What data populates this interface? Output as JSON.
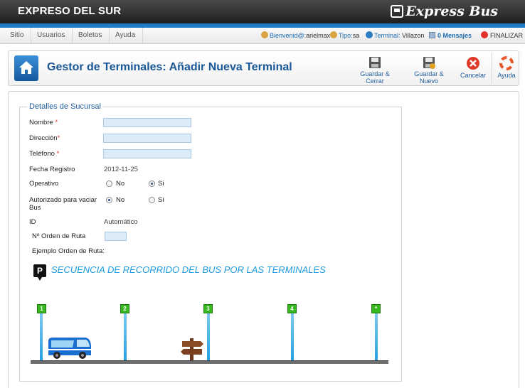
{
  "app": {
    "title": "EXPRESO DEL SUR",
    "brand": "Express Bus"
  },
  "menu": [
    "Sitio",
    "Usuarios",
    "Boletos",
    "Ayuda"
  ],
  "status": {
    "welcome_label": "Bienvenid@:",
    "welcome_user": "arielmax",
    "type_label": "Tipo:",
    "type_value": "sa",
    "terminal_label": "Terminal:",
    "terminal_value": "Villazon",
    "messages": "0 Mensajes",
    "logout": "FINALIZAR"
  },
  "header": {
    "title": "Gestor de Terminales: Añadir Nueva Terminal",
    "buttons": {
      "save_close": "Guardar & Cerrar",
      "save_new": "Guardar & Nuevo",
      "cancel": "Cancelar",
      "help": "Ayuda"
    }
  },
  "form": {
    "legend": "Detalles de Sucursal",
    "nombre_label": "Nombre",
    "direccion_label": "Dirección",
    "telefono_label": "Teléfono",
    "required_mark": "*",
    "nombre_value": "",
    "direccion_value": "",
    "telefono_value": "",
    "fecha_label": "Fecha Registro",
    "fecha_value": "2012-11-25",
    "operativo_label": "Operativo",
    "autorizado_label_1": "Autorizado para vaciar",
    "autorizado_label_2": "Bus",
    "option_no": "No",
    "option_si": "Si",
    "operativo_selected": "Si",
    "autorizado_selected": "No",
    "id_label": "ID",
    "id_value": "Automático",
    "orden_label": "Nº Orden de Ruta",
    "orden_value": "",
    "ejemplo_label": "Ejemplo Orden de Ruta:"
  },
  "route": {
    "parking_letter": "P",
    "title": "SECUENCIA DE RECORRIDO DEL BUS POR LAS TERMINALES",
    "stops": [
      "1",
      "2",
      "3",
      "4",
      "*"
    ]
  },
  "colors": {
    "accent": "#1c7cc7",
    "title_blue": "#1b5796",
    "stop_green": "#37b81f",
    "field_bg": "#dcebf8"
  }
}
